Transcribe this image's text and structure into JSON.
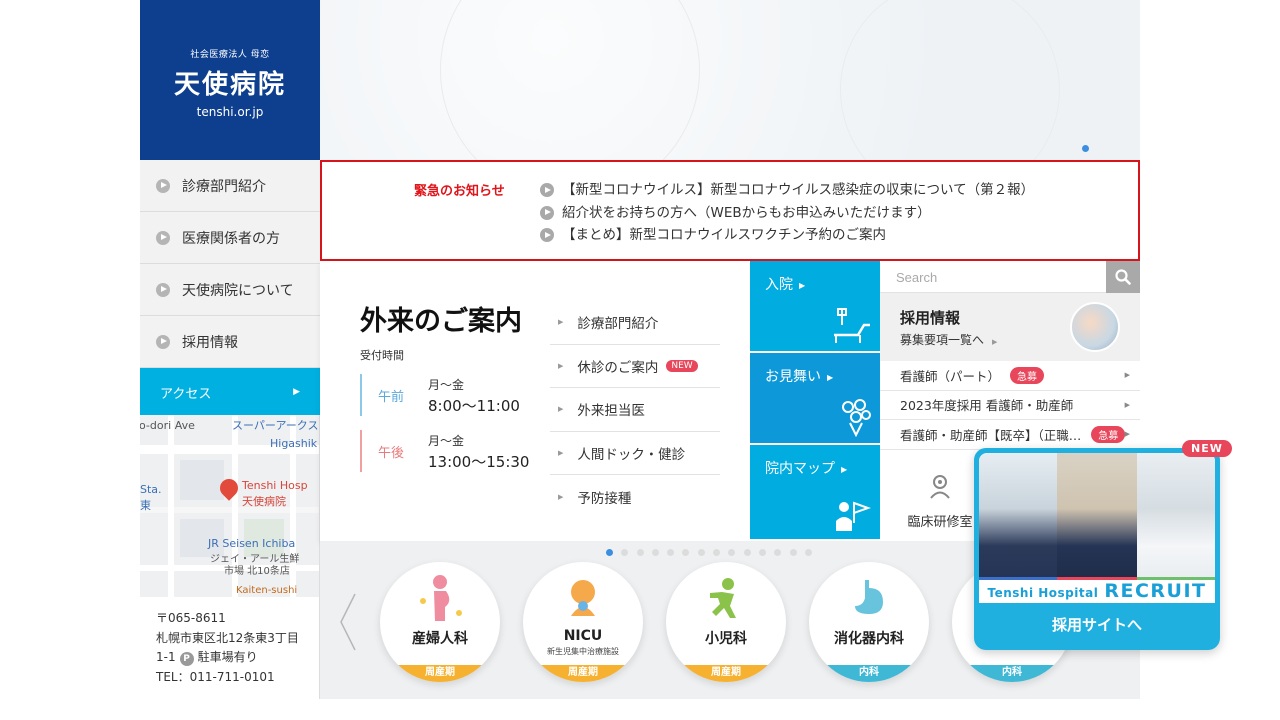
{
  "logo": {
    "sub": "社会医療法人 母恋",
    "name": "天使病院",
    "url": "tenshi.or.jp"
  },
  "side_nav": {
    "items": [
      {
        "label": "診療部門紹介"
      },
      {
        "label": "医療関係者の方"
      },
      {
        "label": "天使病院について"
      },
      {
        "label": "採用情報"
      }
    ],
    "access_label": "アクセス",
    "access_arrow": "▶"
  },
  "map": {
    "street1": "o-dori Ave",
    "place1": "スーパーアークス",
    "place2": "Higashik",
    "hospital_en": "Tenshi Hosp",
    "hospital_ja": "天使病院",
    "left1": "Sta.",
    "left2": "東",
    "market_en": "JR Seisen Ichiba",
    "market_ja1": "ジェイ・アール生鮮",
    "market_ja2": "市場 北10条店",
    "bottom": "Kaiten-sushi"
  },
  "address": {
    "postal": "〒065-8611",
    "line1": "札幌市東区北12条東3丁目",
    "line2_pre": "1-1",
    "parking_icon": "P",
    "parking": "駐車場有り",
    "tel": "TEL：011-711-0101"
  },
  "urgent": {
    "title": "緊急のお知らせ",
    "items": [
      "【新型コロナウイルス】新型コロナウイルス感染症の収束について（第２報）",
      "紹介状をお持ちの方へ（WEBからもお申込みいただけます）",
      "【まとめ】新型コロナウイルスワクチン予約のご案内"
    ]
  },
  "outpatient": {
    "title": "外来のご案内",
    "hours_label": "受付時間",
    "am_tag": "午前",
    "am_days": "月～金",
    "am_time": "8:00～11:00",
    "pm_tag": "午後",
    "pm_days": "月～金",
    "pm_time": "13:00～15:30",
    "links": [
      "診療部門紹介",
      "休診のご案内",
      "外来担当医",
      "人間ドック・健診",
      "予防接種"
    ],
    "new_badge": "NEW",
    "link_marker": "▶"
  },
  "tiles": {
    "nyuin": "入院",
    "omimai": "お見舞い",
    "map": "院内マップ",
    "arrow": "▶"
  },
  "search": {
    "placeholder": "Search"
  },
  "recruit_info": {
    "title": "採用情報",
    "sub": "募集要項一覧へ"
  },
  "jobs": {
    "items": [
      {
        "label": "看護師（パート）"
      },
      {
        "label": "2023年度採用 看護師・助産師"
      },
      {
        "label": "看護師・助産師【既卒】（正職…"
      }
    ],
    "urgent_badge": "急募",
    "arrow": "▶"
  },
  "training": {
    "label": "臨床研修室"
  },
  "carousel": {
    "dot_count": 14,
    "active_index": 0,
    "depts": [
      {
        "name": "産婦人科",
        "sub": "",
        "band": "周産期",
        "band_color": "#f6b131"
      },
      {
        "name": "NICU",
        "sub": "新生児集中治療施設",
        "band": "周産期",
        "band_color": "#f6b131"
      },
      {
        "name": "小児科",
        "sub": "",
        "band": "周産期",
        "band_color": "#f6b131"
      },
      {
        "name": "消化器内科",
        "sub": "",
        "band": "内科",
        "band_color": "#3fb8d6"
      },
      {
        "name": "",
        "sub": "",
        "band": "内科",
        "band_color": "#3fb8d6"
      }
    ]
  },
  "recruit_popup": {
    "new_badge": "NEW",
    "brand_small": "Tenshi Hospital",
    "brand_big": "RECRUIT",
    "cta": "採用サイトへ"
  },
  "colors": {
    "navy": "#0d3f8e",
    "cyan": "#00b0e0",
    "urgent_red": "#d7141a",
    "badge_pink": "#e8465a"
  }
}
